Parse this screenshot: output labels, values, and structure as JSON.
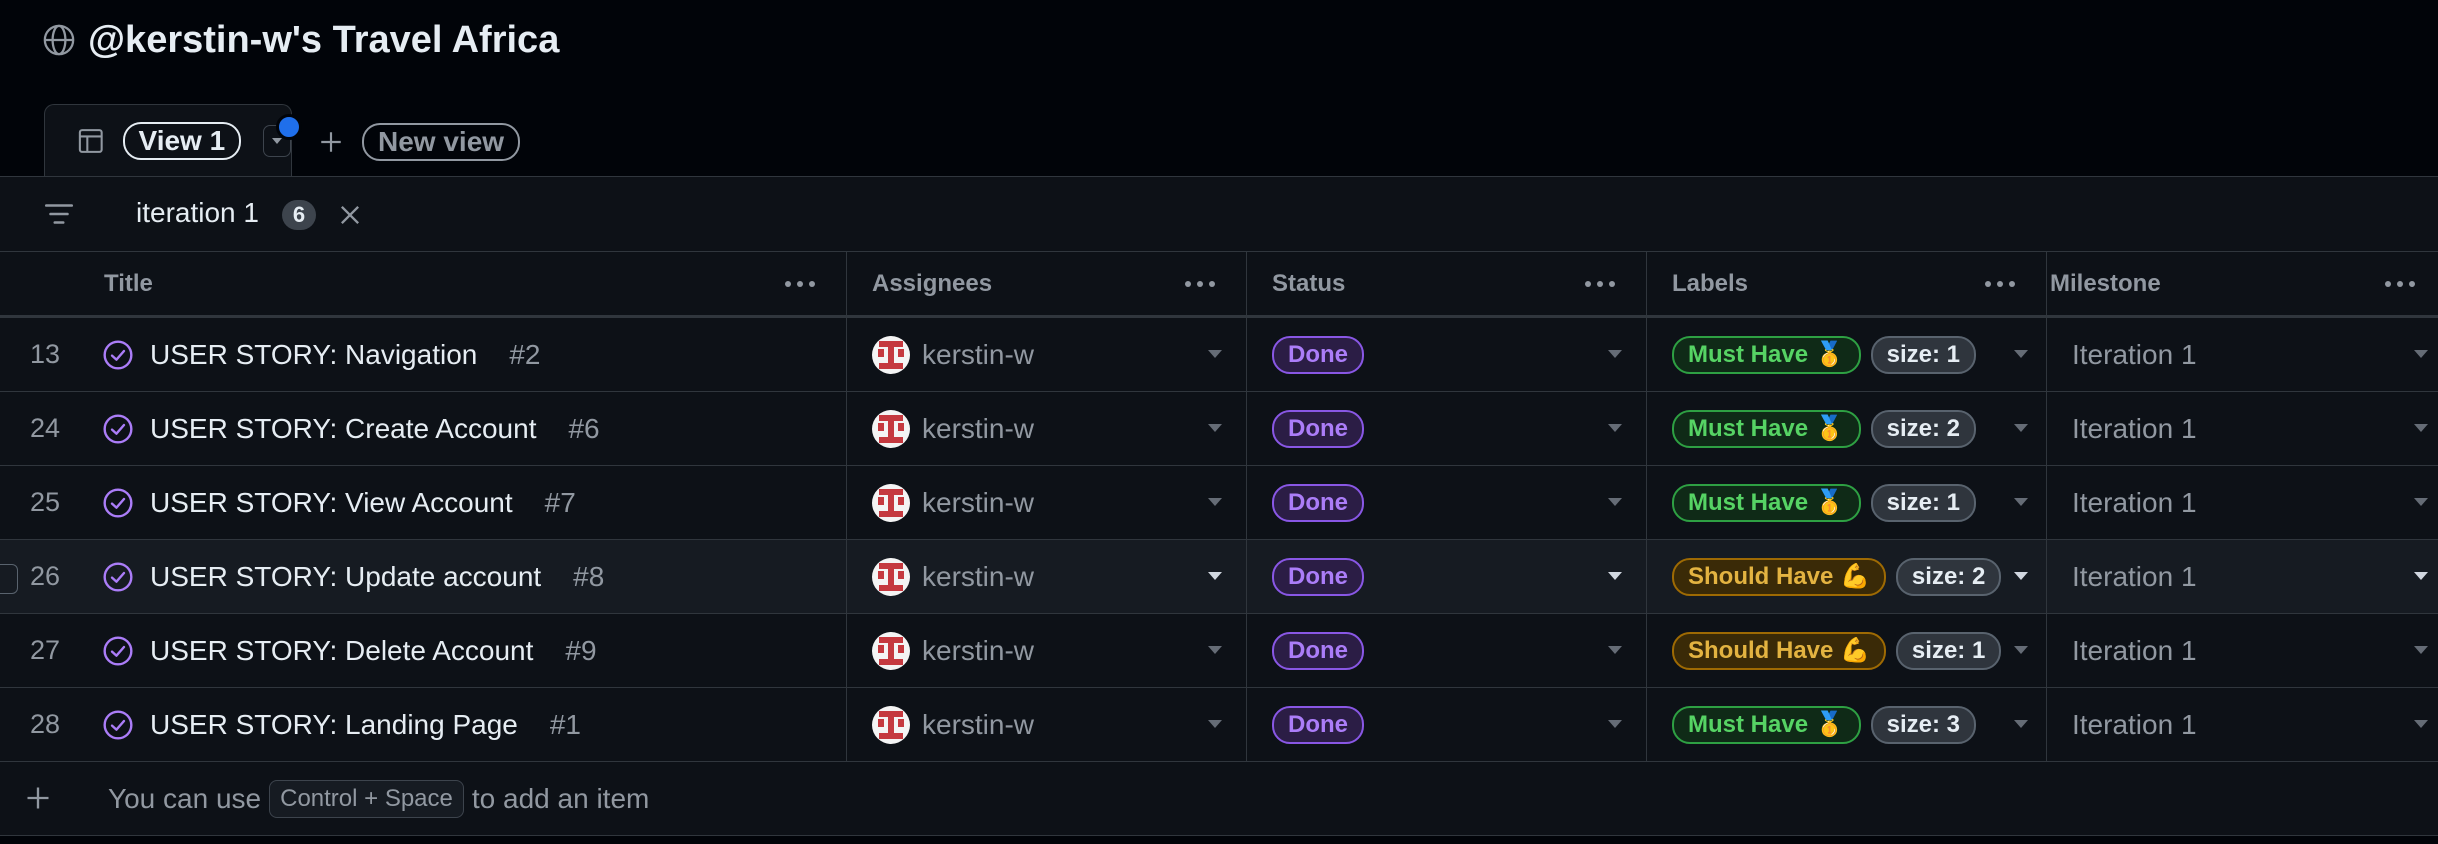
{
  "project": {
    "title": "@kerstin-w's Travel Africa"
  },
  "tabs": {
    "active_label": "View 1",
    "new_view_label": "New view"
  },
  "filter": {
    "text": "iteration 1",
    "count": "6"
  },
  "columns": {
    "title": "Title",
    "assignees": "Assignees",
    "status": "Status",
    "labels": "Labels",
    "milestone": "Milestone"
  },
  "rows": [
    {
      "num": "13",
      "title": "USER STORY: Navigation",
      "issue": "#2",
      "assignee": "kerstin-w",
      "status": "Done",
      "priority": "Must Have 🥇",
      "size": "size: 1",
      "milestone": "Iteration 1"
    },
    {
      "num": "24",
      "title": "USER STORY: Create Account",
      "issue": "#6",
      "assignee": "kerstin-w",
      "status": "Done",
      "priority": "Must Have 🥇",
      "size": "size: 2",
      "milestone": "Iteration 1"
    },
    {
      "num": "25",
      "title": "USER STORY: View Account",
      "issue": "#7",
      "assignee": "kerstin-w",
      "status": "Done",
      "priority": "Must Have 🥇",
      "size": "size: 1",
      "milestone": "Iteration 1"
    },
    {
      "num": "26",
      "title": "USER STORY: Update account",
      "issue": "#8",
      "assignee": "kerstin-w",
      "status": "Done",
      "priority": "Should Have 💪",
      "size": "size: 2",
      "milestone": "Iteration 1"
    },
    {
      "num": "27",
      "title": "USER STORY: Delete Account",
      "issue": "#9",
      "assignee": "kerstin-w",
      "status": "Done",
      "priority": "Should Have 💪",
      "size": "size: 1",
      "milestone": "Iteration 1"
    },
    {
      "num": "28",
      "title": "USER STORY: Landing Page",
      "issue": "#1",
      "assignee": "kerstin-w",
      "status": "Done",
      "priority": "Must Have 🥇",
      "size": "size: 3",
      "milestone": "Iteration 1"
    }
  ],
  "add_item": {
    "prefix": "You can use",
    "shortcut": "Control + Space",
    "suffix": "to add an item"
  },
  "colors": {
    "accent": "#1f6feb",
    "done": "#8957e5",
    "must_have": "#2ea043",
    "should_have": "#9e6a03"
  }
}
